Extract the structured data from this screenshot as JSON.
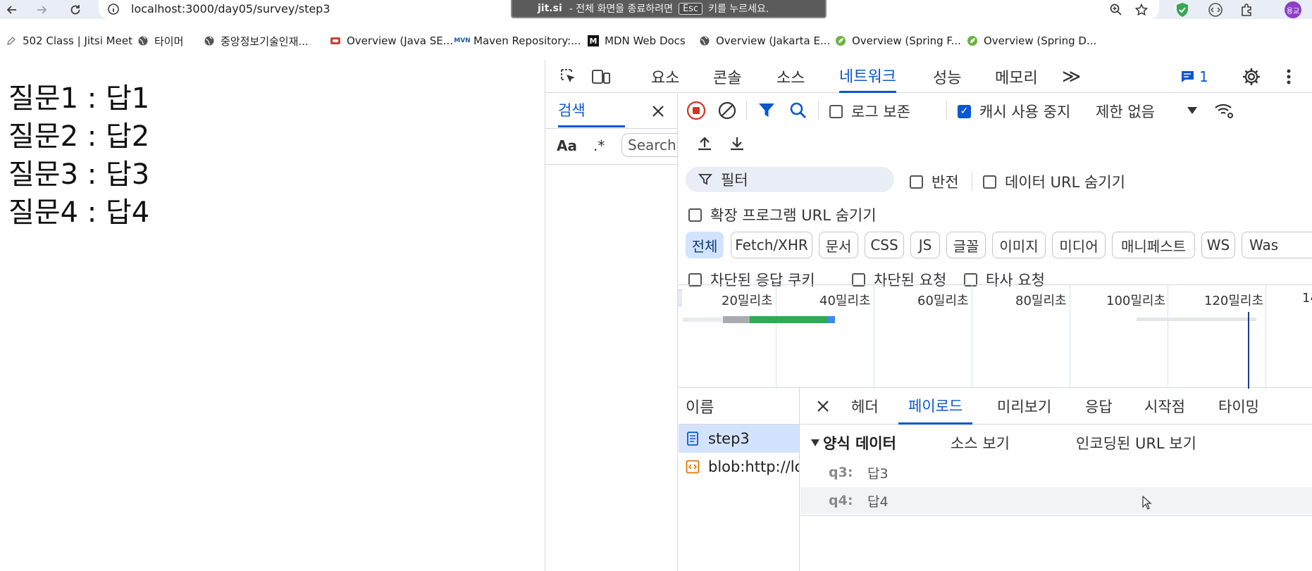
{
  "browser": {
    "url": "localhost:3000/day05/survey/step3",
    "fullscreen_banner": {
      "brand": "jit.si",
      "prefix": "-  전체 화면을 종료하려면",
      "key": "Esc",
      "suffix": "키를 누르세요."
    },
    "profile_label": "용교",
    "bookmarks": [
      {
        "label": "502 Class | Jitsi Meet",
        "icon": "pen-icon"
      },
      {
        "label": "타이머",
        "icon": "globe-icon"
      },
      {
        "label": "중앙정보기술인재...",
        "icon": "globe-icon"
      },
      {
        "label": "Overview (Java SE...",
        "icon": "oracle-icon"
      },
      {
        "label": "Maven Repository:...",
        "icon": "maven-icon"
      },
      {
        "label": "MDN Web Docs",
        "icon": "mdn-icon"
      },
      {
        "label": "Overview (Jakarta E...",
        "icon": "globe-icon"
      },
      {
        "label": "Overview (Spring F...",
        "icon": "spring-icon"
      },
      {
        "label": "Overview (Spring D...",
        "icon": "spring-icon"
      }
    ]
  },
  "page": {
    "answers": [
      "질문1 : 답1",
      "질문2 : 답2",
      "질문3 : 답3",
      "질문4 : 답4"
    ]
  },
  "devtools": {
    "tabs": [
      "요소",
      "콘솔",
      "소스",
      "네트워크",
      "성능",
      "메모리"
    ],
    "active_tab": "네트워크",
    "more_tabs": "≫",
    "message_count": "1",
    "search": {
      "title": "검색",
      "match_case": "Aa",
      "regex": ".*",
      "placeholder": "Search"
    },
    "network": {
      "preserve_log": "로그 보존",
      "disable_cache": "캐시 사용 중지",
      "throttling": "제한 없음",
      "filter_placeholder": "필터",
      "invert": "반전",
      "hide_data_urls": "데이터 URL 숨기기",
      "hide_extension_urls": "확장 프로그램 URL 숨기기",
      "type_filters": [
        "전체",
        "Fetch/XHR",
        "문서",
        "CSS",
        "JS",
        "글꼴",
        "이미지",
        "미디어",
        "매니페스트",
        "WS",
        "Was"
      ],
      "blocked_cookies": "차단된 응답 쿠키",
      "blocked_requests": "차단된 요청",
      "third_party": "타사 요청",
      "timeline_labels": [
        "20밀리초",
        "40밀리초",
        "60밀리초",
        "80밀리초",
        "100밀리초",
        "120밀리초",
        "14"
      ],
      "name_column": "이름",
      "requests": [
        {
          "name": "step3",
          "icon": "document-icon"
        },
        {
          "name": "blob:http://lo...",
          "icon": "script-icon"
        }
      ],
      "detail_tabs": [
        "헤더",
        "페이로드",
        "미리보기",
        "응답",
        "시작점",
        "타이밍"
      ],
      "active_detail_tab": "페이로드",
      "form_data": {
        "title": "양식 데이터",
        "view_source": "소스 보기",
        "view_encoded": "인코딩된 URL 보기",
        "rows": [
          {
            "key": "q3:",
            "value": "답3"
          },
          {
            "key": "q4:",
            "value": "답4"
          }
        ]
      }
    }
  },
  "colors": {
    "accent": "#0b57d0",
    "record_red": "#d93025",
    "waterfall_green": "#34a853",
    "waterfall_gray": "#a8abb2",
    "waterfall_blue": "#4285f4"
  }
}
